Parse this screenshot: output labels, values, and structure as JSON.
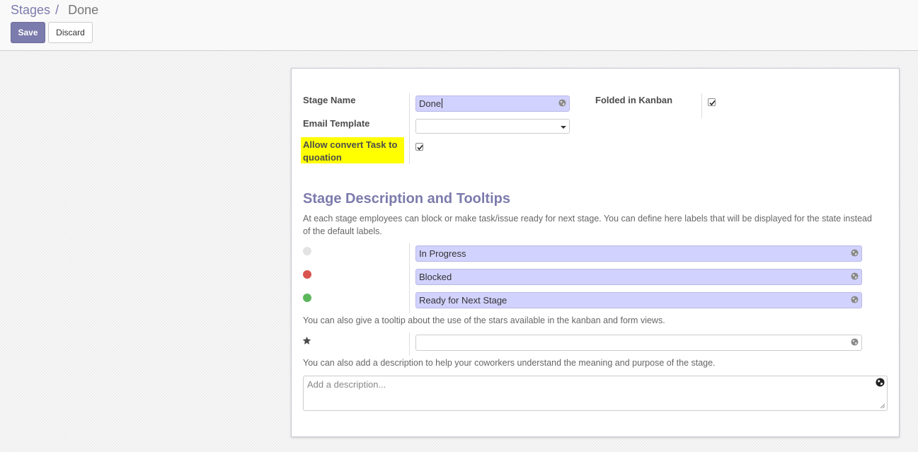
{
  "breadcrumb": {
    "parent": "Stages",
    "separator": "/",
    "current": "Done"
  },
  "buttons": {
    "save": "Save",
    "discard": "Discard"
  },
  "form": {
    "stage_name": {
      "label": "Stage Name",
      "value": "Done"
    },
    "email_template": {
      "label": "Email Template",
      "value": ""
    },
    "allow_convert": {
      "label": "Allow convert Task to quoation",
      "checked": true
    },
    "folded_in_kanban": {
      "label": "Folded in Kanban",
      "checked": true
    }
  },
  "section": {
    "title": "Stage Description and Tooltips",
    "help_states": "At each stage employees can block or make task/issue ready for next stage. You can define here labels that will be displayed for the state instead of the default labels.",
    "states": [
      {
        "color": "#e3e3e3",
        "value": "In Progress"
      },
      {
        "color": "#d9534f",
        "value": "Blocked"
      },
      {
        "color": "#5cb85c",
        "value": "Ready for Next Stage"
      }
    ],
    "help_stars": "You can also give a tooltip about the use of the stars available in the kanban and form views.",
    "star_tooltip_value": "",
    "help_description": "You can also add a description to help your coworkers understand the meaning and purpose of the stage.",
    "description_placeholder": "Add a description..."
  },
  "colors": {
    "accent": "#7c7bad",
    "required_field": "#d2d2ff",
    "highlight": "#ffff00"
  },
  "icons": {
    "translate": "globe-icon",
    "dropdown": "caret-down-icon",
    "star": "star-icon",
    "checkbox": "checkmark-icon"
  }
}
